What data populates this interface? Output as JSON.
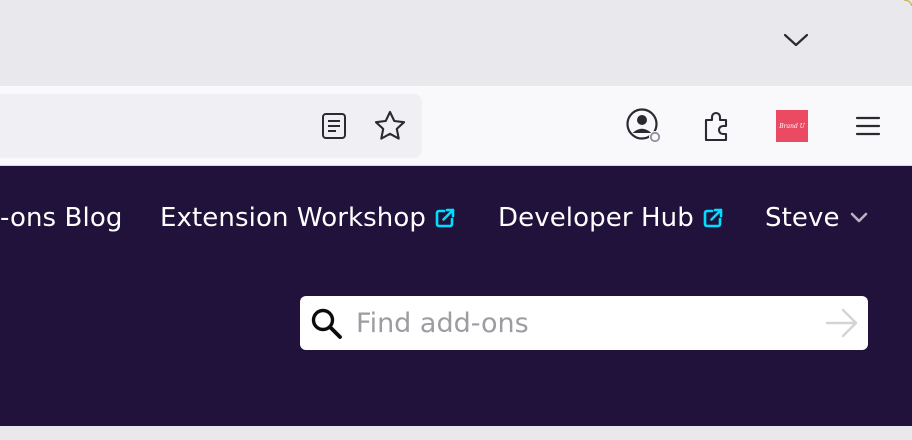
{
  "tabstrip": {
    "list_all_tabs_icon": "chevron-down-icon"
  },
  "toolbar": {
    "reader_view_icon": "reader-view-icon",
    "bookmark_icon": "star-icon",
    "account_icon": "account-icon",
    "extensions_icon": "puzzle-piece-icon",
    "extension_badge_text": "Brand U",
    "extension_badge_color": "#ea4a62",
    "menu_icon": "hamburger-menu-icon"
  },
  "header": {
    "links": [
      {
        "label": "-ons Blog",
        "external": false
      },
      {
        "label": "Extension Workshop",
        "external": true
      },
      {
        "label": "Developer Hub",
        "external": true
      }
    ],
    "user_menu_label": "Steve",
    "background_color": "#20123a",
    "external_icon_color": "#00ddff"
  },
  "search": {
    "placeholder": "Find add-ons",
    "value": ""
  }
}
